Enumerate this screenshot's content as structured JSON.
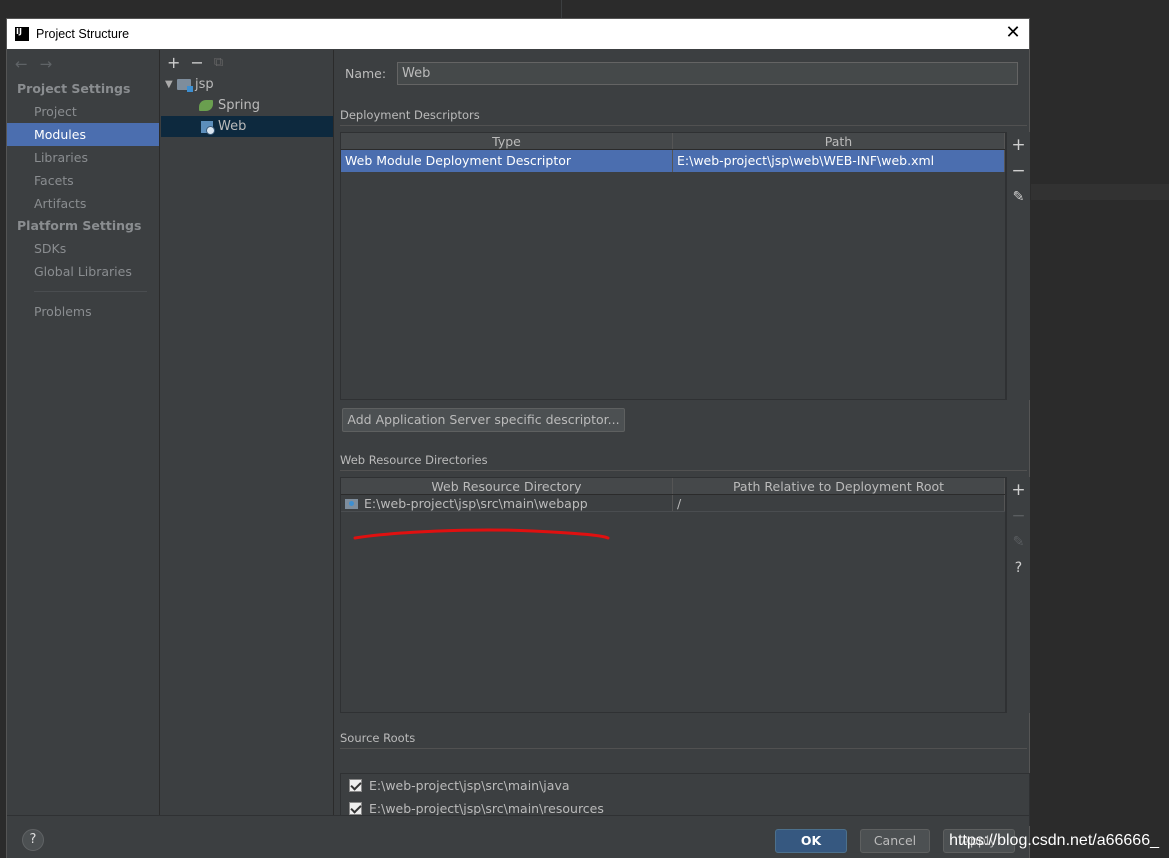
{
  "window": {
    "title": "Project Structure",
    "logo": "IJ"
  },
  "nav": {
    "back_icon": "←",
    "forward_icon": "→",
    "project_settings": "Project Settings",
    "items_project": [
      "Project",
      "Modules",
      "Libraries",
      "Facets",
      "Artifacts"
    ],
    "platform_settings": "Platform Settings",
    "items_platform": [
      "SDKs",
      "Global Libraries"
    ],
    "problems": "Problems"
  },
  "tree": {
    "add_icon": "+",
    "remove_icon": "−",
    "copy_icon": "⧉",
    "root": "jsp",
    "children": [
      "Spring",
      "Web"
    ]
  },
  "module": {
    "name_label": "Name:",
    "name_value": "Web"
  },
  "deployment": {
    "title": "Deployment Descriptors",
    "columns": [
      "Type",
      "Path"
    ],
    "rows": [
      {
        "type": "Web Module Deployment Descriptor",
        "path": "E:\\web-project\\jsp\\web\\WEB-INF\\web.xml"
      }
    ],
    "add_button": "Add Application Server specific descriptor..."
  },
  "web_resources": {
    "title": "Web Resource Directories",
    "columns": [
      "Web Resource Directory",
      "Path Relative to Deployment Root"
    ],
    "rows": [
      {
        "directory": "E:\\web-project\\jsp\\src\\main\\webapp",
        "relative": "/"
      }
    ]
  },
  "source_roots": {
    "title": "Source Roots",
    "items": [
      "E:\\web-project\\jsp\\src\\main\\java",
      "E:\\web-project\\jsp\\src\\main\\resources"
    ]
  },
  "tools": {
    "add": "+",
    "remove": "−",
    "edit": "✎",
    "help": "?"
  },
  "footer": {
    "help": "?",
    "ok": "OK",
    "cancel": "Cancel",
    "apply": "Apply"
  },
  "watermark": "https://blog.csdn.net/a66666_",
  "colors": {
    "selection": "#4b6eaf",
    "annotation": "#e01010"
  }
}
